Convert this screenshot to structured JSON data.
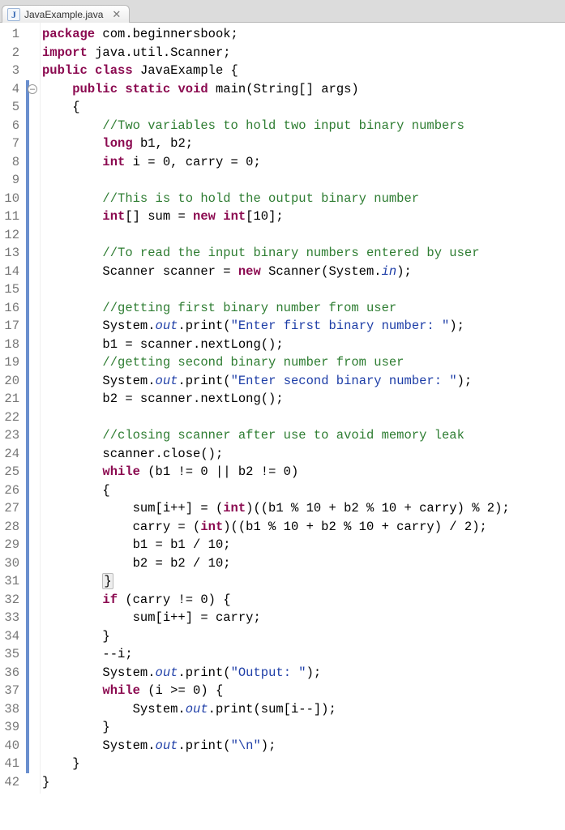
{
  "tab": {
    "icon_letter": "J",
    "filename": "JavaExample.java",
    "close_glyph": "✕"
  },
  "editor": {
    "highlight_line": 26,
    "fold_marker_line": 4,
    "line_numbers": [
      "1",
      "2",
      "3",
      "4",
      "5",
      "6",
      "7",
      "8",
      "9",
      "10",
      "11",
      "12",
      "13",
      "14",
      "15",
      "16",
      "17",
      "18",
      "19",
      "20",
      "21",
      "22",
      "23",
      "24",
      "25",
      "26",
      "27",
      "28",
      "29",
      "30",
      "31",
      "32",
      "33",
      "34",
      "35",
      "36",
      "37",
      "38",
      "39",
      "40",
      "41",
      "42"
    ],
    "blue_bar_lines": [
      4,
      5,
      6,
      7,
      8,
      9,
      10,
      11,
      12,
      13,
      14,
      15,
      16,
      17,
      18,
      19,
      20,
      21,
      22,
      23,
      24,
      25,
      26,
      27,
      28,
      29,
      30,
      31,
      32,
      33,
      34,
      35,
      36,
      37,
      38,
      39,
      40,
      41
    ],
    "lines": {
      "l1": {
        "pre": "",
        "segs": [
          {
            "c": "kw",
            "t": "package"
          },
          {
            "c": "",
            "t": " com.beginnersbook;"
          }
        ]
      },
      "l2": {
        "pre": "",
        "segs": [
          {
            "c": "kw",
            "t": "import"
          },
          {
            "c": "",
            "t": " java.util.Scanner;"
          }
        ]
      },
      "l3": {
        "pre": "",
        "segs": [
          {
            "c": "kw",
            "t": "public"
          },
          {
            "c": "",
            "t": " "
          },
          {
            "c": "kw",
            "t": "class"
          },
          {
            "c": "",
            "t": " JavaExample {"
          }
        ]
      },
      "l4": {
        "pre": "    ",
        "segs": [
          {
            "c": "kw",
            "t": "public"
          },
          {
            "c": "",
            "t": " "
          },
          {
            "c": "kw",
            "t": "static"
          },
          {
            "c": "",
            "t": " "
          },
          {
            "c": "kw",
            "t": "void"
          },
          {
            "c": "",
            "t": " main(String[] args)"
          }
        ]
      },
      "l5": {
        "pre": "    ",
        "segs": [
          {
            "c": "",
            "t": "{"
          }
        ]
      },
      "l6": {
        "pre": "        ",
        "segs": [
          {
            "c": "cmt",
            "t": "//Two variables to hold two input binary numbers"
          }
        ]
      },
      "l7": {
        "pre": "        ",
        "segs": [
          {
            "c": "kw",
            "t": "long"
          },
          {
            "c": "",
            "t": " b1, b2;"
          }
        ]
      },
      "l8": {
        "pre": "        ",
        "segs": [
          {
            "c": "kw",
            "t": "int"
          },
          {
            "c": "",
            "t": " i = 0, carry = 0;"
          }
        ]
      },
      "l9": {
        "pre": "",
        "segs": [
          {
            "c": "",
            "t": ""
          }
        ]
      },
      "l10": {
        "pre": "        ",
        "segs": [
          {
            "c": "cmt",
            "t": "//This is to hold the output binary number"
          }
        ]
      },
      "l11": {
        "pre": "        ",
        "segs": [
          {
            "c": "kw",
            "t": "int"
          },
          {
            "c": "",
            "t": "[] sum = "
          },
          {
            "c": "kw",
            "t": "new"
          },
          {
            "c": "",
            "t": " "
          },
          {
            "c": "kw",
            "t": "int"
          },
          {
            "c": "",
            "t": "[10];"
          }
        ]
      },
      "l12": {
        "pre": "",
        "segs": [
          {
            "c": "",
            "t": ""
          }
        ]
      },
      "l13": {
        "pre": "        ",
        "segs": [
          {
            "c": "cmt",
            "t": "//To read the input binary numbers entered by user"
          }
        ]
      },
      "l14": {
        "pre": "        ",
        "segs": [
          {
            "c": "",
            "t": "Scanner scanner = "
          },
          {
            "c": "kw",
            "t": "new"
          },
          {
            "c": "",
            "t": " Scanner(System."
          },
          {
            "c": "fld",
            "t": "in"
          },
          {
            "c": "",
            "t": ");"
          }
        ]
      },
      "l15": {
        "pre": "",
        "segs": [
          {
            "c": "",
            "t": ""
          }
        ]
      },
      "l16": {
        "pre": "        ",
        "segs": [
          {
            "c": "cmt",
            "t": "//getting first binary number from user"
          }
        ]
      },
      "l17": {
        "pre": "        ",
        "segs": [
          {
            "c": "",
            "t": "System."
          },
          {
            "c": "fld",
            "t": "out"
          },
          {
            "c": "",
            "t": ".print("
          },
          {
            "c": "str",
            "t": "\"Enter first binary number: \""
          },
          {
            "c": "",
            "t": ");"
          }
        ]
      },
      "l18": {
        "pre": "        ",
        "segs": [
          {
            "c": "",
            "t": "b1 = scanner.nextLong();"
          }
        ]
      },
      "l19": {
        "pre": "        ",
        "segs": [
          {
            "c": "cmt",
            "t": "//getting second binary number from user"
          }
        ]
      },
      "l20": {
        "pre": "        ",
        "segs": [
          {
            "c": "",
            "t": "System."
          },
          {
            "c": "fld",
            "t": "out"
          },
          {
            "c": "",
            "t": ".print("
          },
          {
            "c": "str",
            "t": "\"Enter second binary number: \""
          },
          {
            "c": "",
            "t": ");"
          }
        ]
      },
      "l21": {
        "pre": "        ",
        "segs": [
          {
            "c": "",
            "t": "b2 = scanner.nextLong();"
          }
        ]
      },
      "l22": {
        "pre": "",
        "segs": [
          {
            "c": "",
            "t": ""
          }
        ]
      },
      "l23": {
        "pre": "        ",
        "segs": [
          {
            "c": "cmt",
            "t": "//closing scanner after use to avoid memory leak"
          }
        ]
      },
      "l24": {
        "pre": "        ",
        "segs": [
          {
            "c": "",
            "t": "scanner.close();"
          }
        ]
      },
      "l25": {
        "pre": "        ",
        "segs": [
          {
            "c": "kw",
            "t": "while"
          },
          {
            "c": "",
            "t": " (b1 != 0 || b2 != 0)"
          }
        ]
      },
      "l26": {
        "pre": "        ",
        "segs": [
          {
            "c": "",
            "t": "{"
          }
        ]
      },
      "l27": {
        "pre": "            ",
        "segs": [
          {
            "c": "",
            "t": "sum[i++] = ("
          },
          {
            "c": "kw",
            "t": "int"
          },
          {
            "c": "",
            "t": ")((b1 % 10 + b2 % 10 + carry) % 2);"
          }
        ]
      },
      "l28": {
        "pre": "            ",
        "segs": [
          {
            "c": "",
            "t": "carry = ("
          },
          {
            "c": "kw",
            "t": "int"
          },
          {
            "c": "",
            "t": ")((b1 % 10 + b2 % 10 + carry) / 2);"
          }
        ]
      },
      "l29": {
        "pre": "            ",
        "segs": [
          {
            "c": "",
            "t": "b1 = b1 / 10;"
          }
        ]
      },
      "l30": {
        "pre": "            ",
        "segs": [
          {
            "c": "",
            "t": "b2 = b2 / 10;"
          }
        ]
      },
      "l31": {
        "pre": "        ",
        "segs": [
          {
            "c": "brace-hi",
            "t": "}"
          }
        ]
      },
      "l32": {
        "pre": "        ",
        "segs": [
          {
            "c": "kw",
            "t": "if"
          },
          {
            "c": "",
            "t": " (carry != 0) {"
          }
        ]
      },
      "l33": {
        "pre": "            ",
        "segs": [
          {
            "c": "",
            "t": "sum[i++] = carry;"
          }
        ]
      },
      "l34": {
        "pre": "        ",
        "segs": [
          {
            "c": "",
            "t": "}"
          }
        ]
      },
      "l35": {
        "pre": "        ",
        "segs": [
          {
            "c": "",
            "t": "--i;"
          }
        ]
      },
      "l36": {
        "pre": "        ",
        "segs": [
          {
            "c": "",
            "t": "System."
          },
          {
            "c": "fld",
            "t": "out"
          },
          {
            "c": "",
            "t": ".print("
          },
          {
            "c": "str",
            "t": "\"Output: \""
          },
          {
            "c": "",
            "t": ");"
          }
        ]
      },
      "l37": {
        "pre": "        ",
        "segs": [
          {
            "c": "kw",
            "t": "while"
          },
          {
            "c": "",
            "t": " (i >= 0) {"
          }
        ]
      },
      "l38": {
        "pre": "            ",
        "segs": [
          {
            "c": "",
            "t": "System."
          },
          {
            "c": "fld",
            "t": "out"
          },
          {
            "c": "",
            "t": ".print(sum[i--]);"
          }
        ]
      },
      "l39": {
        "pre": "        ",
        "segs": [
          {
            "c": "",
            "t": "}"
          }
        ]
      },
      "l40": {
        "pre": "        ",
        "segs": [
          {
            "c": "",
            "t": "System."
          },
          {
            "c": "fld",
            "t": "out"
          },
          {
            "c": "",
            "t": ".print("
          },
          {
            "c": "str",
            "t": "\"\\n\""
          },
          {
            "c": "",
            "t": ");"
          }
        ]
      },
      "l41": {
        "pre": "    ",
        "segs": [
          {
            "c": "",
            "t": "}"
          }
        ]
      },
      "l42": {
        "pre": "",
        "segs": [
          {
            "c": "",
            "t": "}"
          }
        ]
      }
    }
  }
}
